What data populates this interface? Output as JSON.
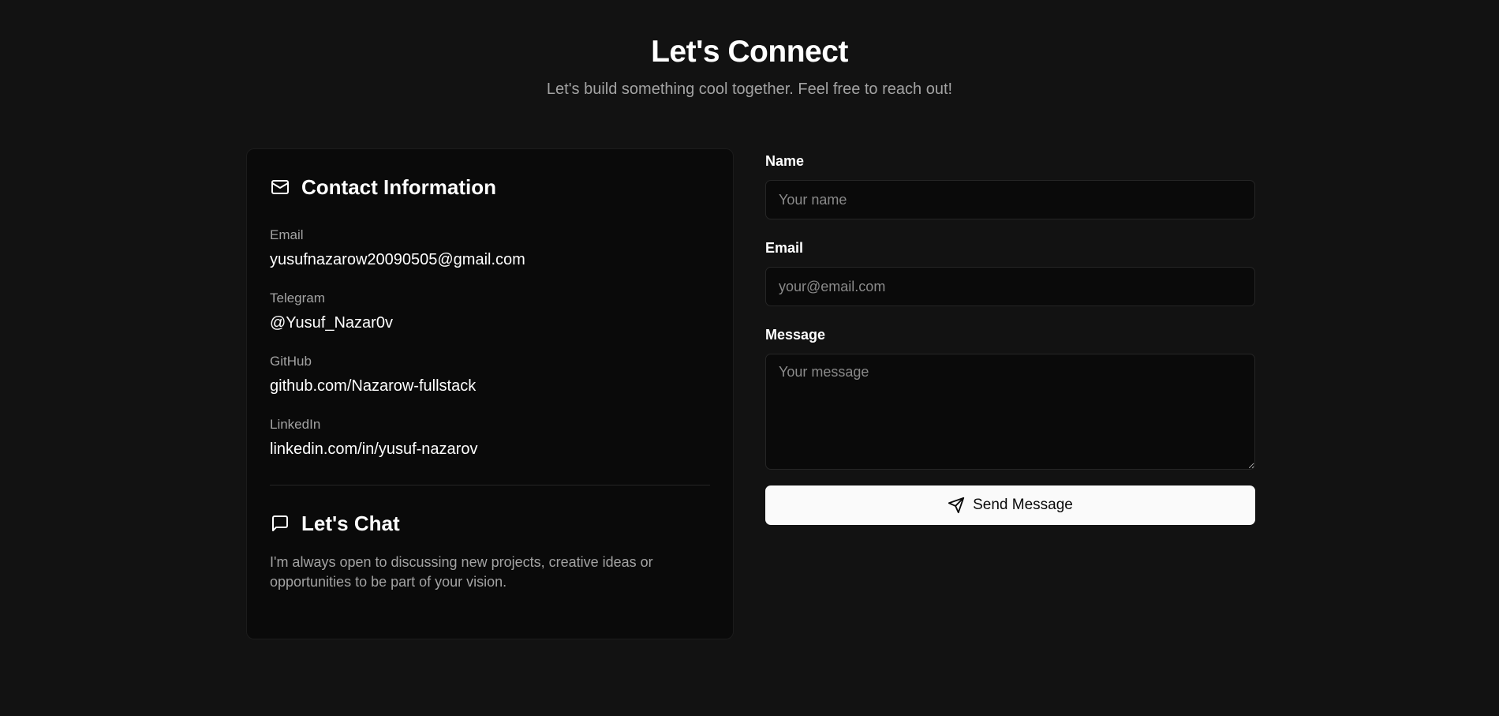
{
  "hero": {
    "title": "Let's Connect",
    "subtitle": "Let's build something cool together. Feel free to reach out!"
  },
  "contact": {
    "title": "Contact Information",
    "icon": "mail-icon",
    "items": [
      {
        "label": "Email",
        "value": "yusufnazarow20090505@gmail.com"
      },
      {
        "label": "Telegram",
        "value": "@Yusuf_Nazar0v"
      },
      {
        "label": "GitHub",
        "value": "github.com/Nazarow-fullstack"
      },
      {
        "label": "LinkedIn",
        "value": "linkedin.com/in/yusuf-nazarov"
      }
    ]
  },
  "chat": {
    "title": "Let's Chat",
    "icon": "message-square-icon",
    "text": "I'm always open to discussing new projects, creative ideas or opportunities to be part of your vision."
  },
  "form": {
    "name_label": "Name",
    "name_placeholder": "Your name",
    "email_label": "Email",
    "email_placeholder": "your@email.com",
    "message_label": "Message",
    "message_placeholder": "Your message",
    "submit_label": "Send Message",
    "submit_icon": "send-icon"
  },
  "colors": {
    "background": "#121212",
    "card": "#0a0a0a",
    "muted_text": "#a3a3a3",
    "button": "#fafafa"
  }
}
